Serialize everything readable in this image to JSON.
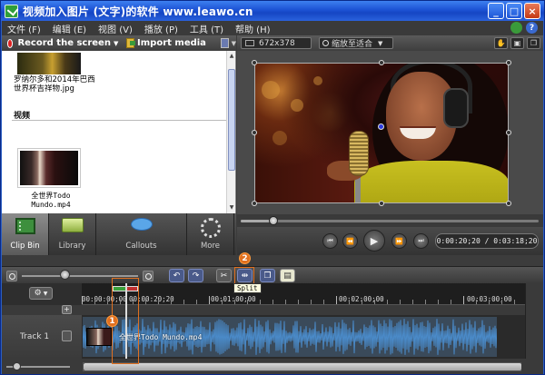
{
  "window": {
    "title": "视频加入图片 (文字)的软件 www.leawo.cn",
    "buttons": {
      "minimize": "_",
      "maximize": "□",
      "close": "×"
    }
  },
  "menu": {
    "items": [
      "文件 (F)",
      "编辑 (E)",
      "视图 (V)",
      "播放 (P)",
      "工具 (T)",
      "帮助 (H)"
    ],
    "help_glyph": "?"
  },
  "left_toolbar": {
    "record_label": "Record the screen",
    "import_label": "Import media"
  },
  "clip_bin": {
    "image_caption": "罗纳尔多和2014年巴西世界杯吉祥物.jpg",
    "video_section": "视频",
    "video_caption": "全世界Todo Mundo.mp4"
  },
  "task_tabs": [
    {
      "label": "Clip Bin",
      "icon": "film-icon",
      "active": true
    },
    {
      "label": "Library",
      "icon": "folder-icon",
      "active": false
    },
    {
      "label": "Callouts",
      "icon": "speech-bubble-icon",
      "active": false
    },
    {
      "label": "More",
      "icon": "dots-icon",
      "active": false
    }
  ],
  "preview_toolbar": {
    "canvas_size": "672x378",
    "zoom_label": "缩放至适合"
  },
  "playback": {
    "time": "0:00:20;20 / 0:03:18;20",
    "progress": 0.11,
    "buttons": [
      "skip-back",
      "rewind",
      "play",
      "fast-forward",
      "skip-end"
    ]
  },
  "timeline": {
    "split_tooltip": "Split",
    "ruler_labels": [
      "00:00:00;00",
      "00:00:20;20",
      "00:01:00;00",
      "00:02:00;00",
      "00:03:00;00"
    ],
    "track_name": "Track 1",
    "clip_name": "全世界Todo Mundo.mp4",
    "add_track_glyph": "+"
  },
  "annotations": {
    "one": "1",
    "two": "2"
  },
  "colors": {
    "annotation": "#e07020",
    "waveform": "#4a8ac8",
    "clip": "#3a4a5a"
  }
}
